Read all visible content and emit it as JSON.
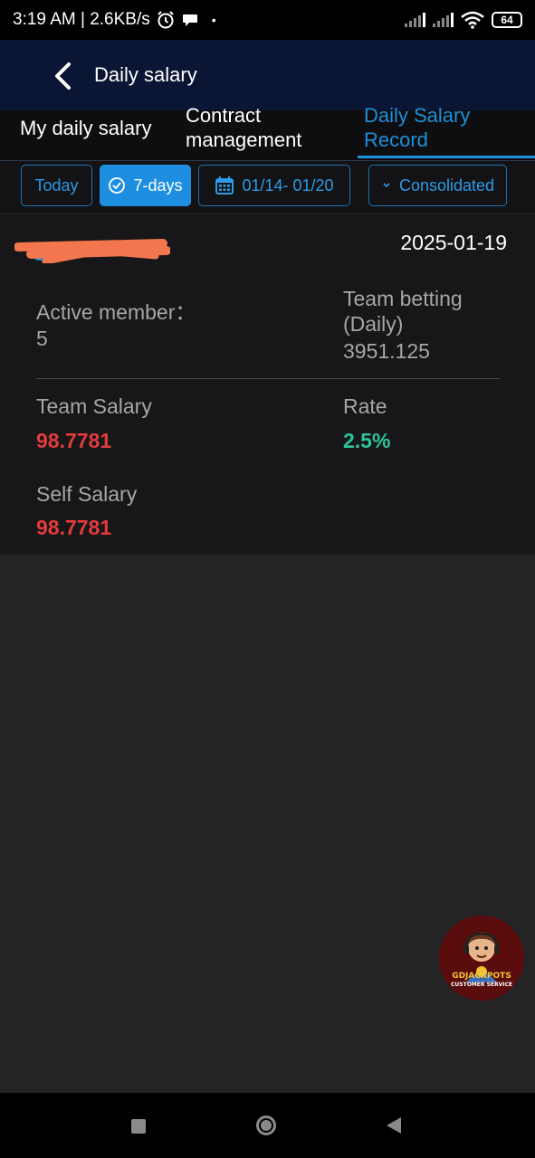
{
  "status_bar": {
    "time_speed": "3:19 AM | 2.6KB/s",
    "battery": "64"
  },
  "header": {
    "title": "Daily salary"
  },
  "tabs": [
    {
      "label": "My daily salary",
      "active": false
    },
    {
      "label": "Contract management",
      "active": false
    },
    {
      "label": "Daily Salary Record",
      "active": true
    }
  ],
  "filters": {
    "today": "Today",
    "seven_days": "7-days",
    "date_range": "01/14- 01/20",
    "consolidated": "Consolidated"
  },
  "record": {
    "date": "2025-01-19",
    "active_member_label": "Active member：",
    "active_member_value": "5",
    "team_betting_label": "Team betting (Daily)",
    "team_betting_value": "3951.125",
    "team_salary_label": "Team Salary",
    "team_salary_value": "98.7781",
    "rate_label": "Rate",
    "rate_value": "2.5%",
    "self_salary_label": "Self Salary",
    "self_salary_value": "98.7781"
  },
  "cs_widget": {
    "line1": "GDJACKPOTS",
    "line2": "CUSTOMER SERVICE"
  },
  "colors": {
    "accent": "#1d8fdb",
    "red_value": "#e23b3b",
    "green_value": "#2fc49a",
    "header_bg": "#0b1634"
  }
}
